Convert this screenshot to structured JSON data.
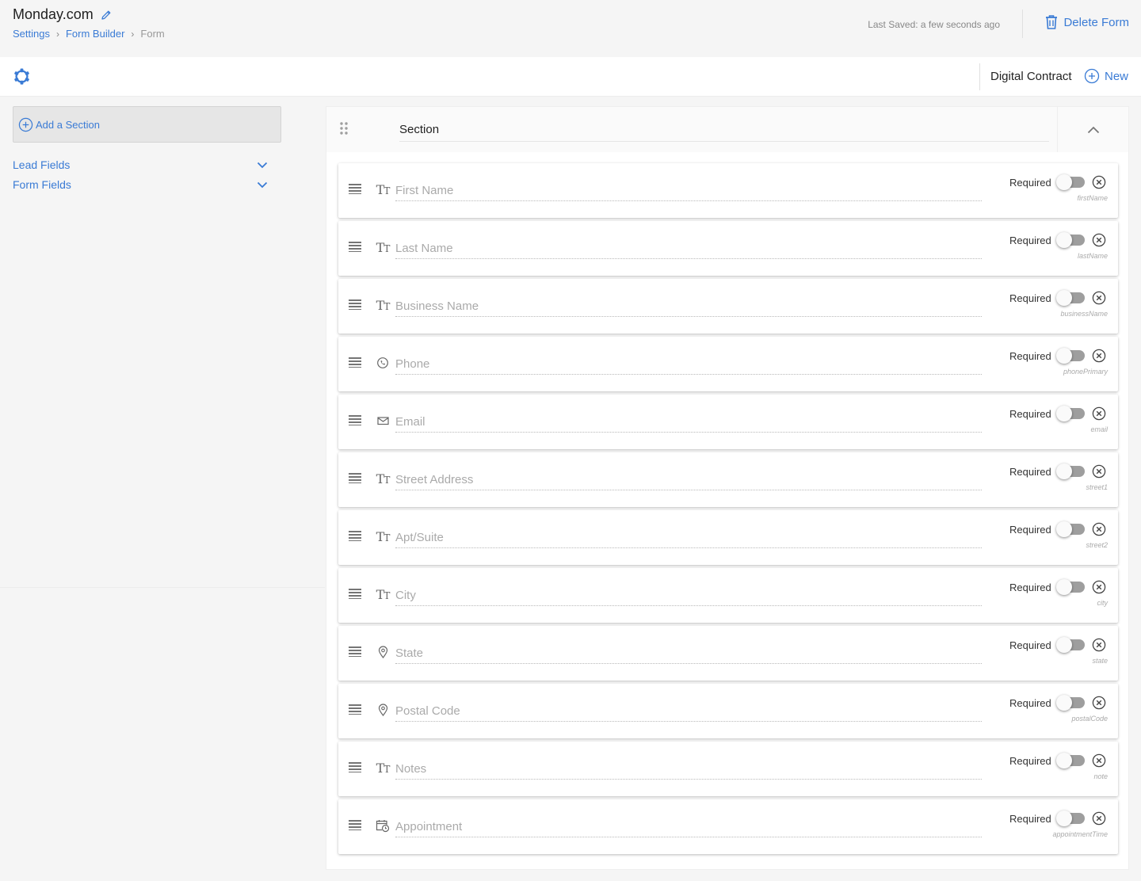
{
  "header": {
    "app_title": "Monday.com",
    "breadcrumb": [
      "Settings",
      "Form Builder",
      "Form"
    ],
    "last_saved_label": "Last Saved:",
    "last_saved_value": "a few seconds ago",
    "delete_label": "Delete Form"
  },
  "toolbar": {
    "contract_label": "Digital Contract",
    "new_label": "New"
  },
  "sidebar": {
    "add_section_label": "Add a Section",
    "groups": [
      "Lead Fields",
      "Form Fields"
    ]
  },
  "section": {
    "title": "Section"
  },
  "fields": [
    {
      "label": "First Name",
      "key": "firstName",
      "icon": "text-icon",
      "required": false
    },
    {
      "label": "Last Name",
      "key": "lastName",
      "icon": "text-icon",
      "required": false
    },
    {
      "label": "Business Name",
      "key": "businessName",
      "icon": "text-icon",
      "required": false
    },
    {
      "label": "Phone",
      "key": "phonePrimary",
      "icon": "phone-icon",
      "required": false
    },
    {
      "label": "Email",
      "key": "email",
      "icon": "email-icon",
      "required": false
    },
    {
      "label": "Street Address",
      "key": "street1",
      "icon": "text-icon",
      "required": false
    },
    {
      "label": "Apt/Suite",
      "key": "street2",
      "icon": "text-icon",
      "required": false
    },
    {
      "label": "City",
      "key": "city",
      "icon": "text-icon",
      "required": false
    },
    {
      "label": "State",
      "key": "state",
      "icon": "location-pin-icon",
      "required": false
    },
    {
      "label": "Postal Code",
      "key": "postalCode",
      "icon": "location-pin-icon",
      "required": false
    },
    {
      "label": "Notes",
      "key": "note",
      "icon": "text-icon",
      "required": false
    },
    {
      "label": "Appointment",
      "key": "appointmentTime",
      "icon": "calendar-clock-icon",
      "required": false
    }
  ],
  "required_label": "Required",
  "colors": {
    "accent": "#3a7bd5",
    "toggle_off": "#9e9e9e"
  }
}
